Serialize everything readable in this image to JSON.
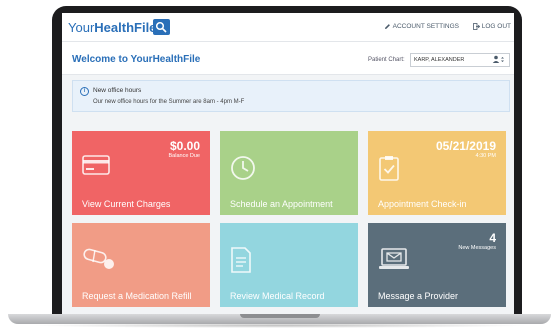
{
  "header": {
    "logo_prefix": "Your",
    "logo_main": "HealthFile",
    "logo_suffix": "®",
    "account_settings": "ACCOUNT SETTINGS",
    "logout": "LOG OUT"
  },
  "welcome": {
    "title": "Welcome to YourHealthFile",
    "patient_chart_label": "Patient Chart:",
    "patient_chart_value": "KARP, ALEXANDER"
  },
  "notice": {
    "title": "New office hours",
    "body": "Our new office hours for the Summer are 8am - 4pm M-F"
  },
  "tiles": [
    {
      "label": "View Current Charges",
      "value": "$0.00",
      "sub": "Balance Due",
      "icon": "credit-card-icon",
      "color": "#f06465"
    },
    {
      "label": "Schedule an Appointment",
      "icon": "clock-icon",
      "color": "#a9d189"
    },
    {
      "label": "Appointment Check-in",
      "value": "05/21/2019",
      "sub": "4:30 PM",
      "icon": "clipboard-check-icon",
      "color": "#f3c874"
    },
    {
      "label": "Request a Medication Refill",
      "icon": "pill-icon",
      "color": "#f19c86"
    },
    {
      "label": "Review Medical Record",
      "icon": "document-icon",
      "color": "#93d6df"
    },
    {
      "label": "Message a Provider",
      "value": "4",
      "sub": "New Messages",
      "icon": "laptop-message-icon",
      "color": "#5b6e7b"
    }
  ],
  "colors": {
    "brand": "#2a6fb8",
    "frame": "#1c1c1e"
  }
}
